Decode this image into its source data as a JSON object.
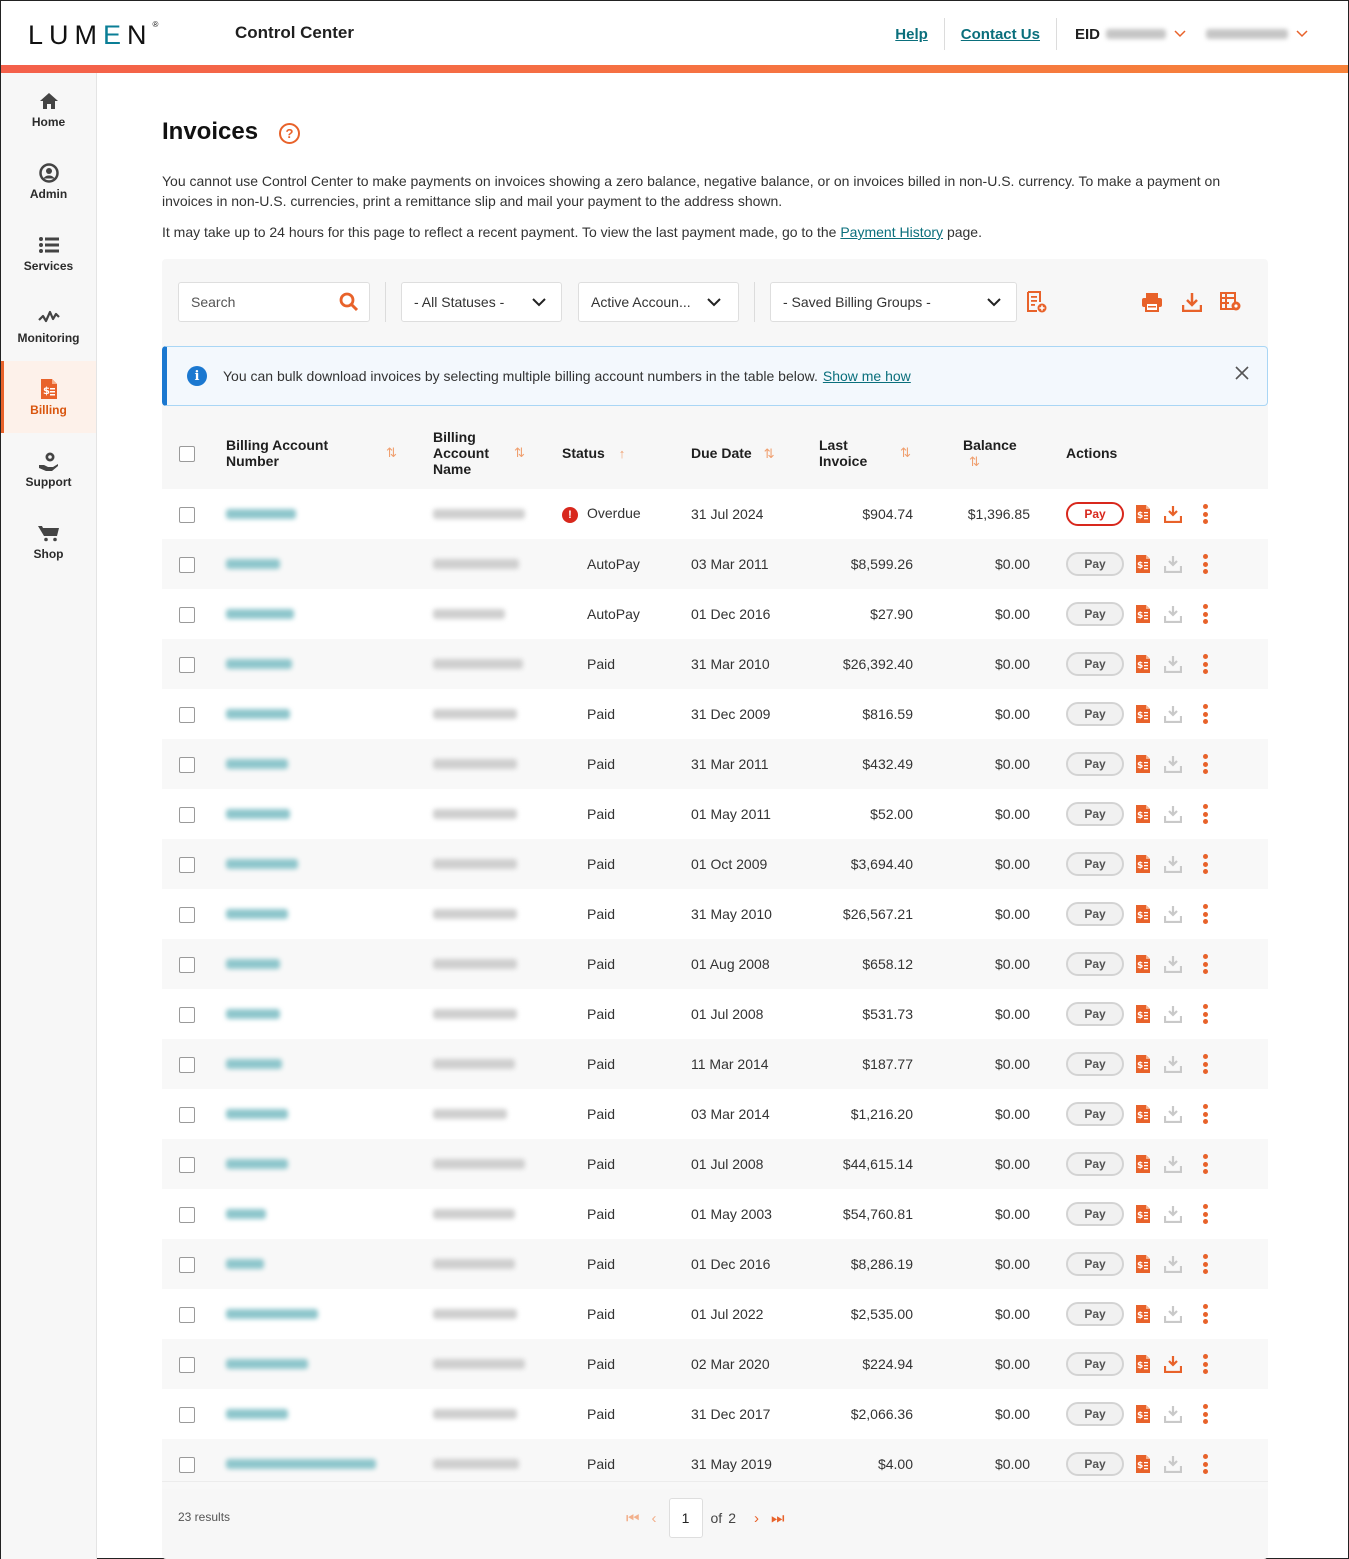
{
  "header": {
    "logo": "LUMEN",
    "app_title": "Control Center",
    "help_label": "Help",
    "contact_label": "Contact Us",
    "eid_label": "EID"
  },
  "sidebar": {
    "items": [
      {
        "label": "Home",
        "icon": "home-icon"
      },
      {
        "label": "Admin",
        "icon": "user-icon"
      },
      {
        "label": "Services",
        "icon": "list-icon"
      },
      {
        "label": "Monitoring",
        "icon": "pulse-icon"
      },
      {
        "label": "Billing",
        "icon": "invoice-icon",
        "active": true
      },
      {
        "label": "Support",
        "icon": "support-icon"
      },
      {
        "label": "Shop",
        "icon": "cart-icon"
      }
    ]
  },
  "page": {
    "title": "Invoices",
    "description": "You cannot use Control Center to make payments on invoices showing a zero balance, negative balance, or on invoices billed in non-U.S. currency. To make a payment on invoices in non-U.S. currencies, print a remittance slip and mail your payment to the address shown.",
    "note_prefix": "It may take up to 24 hours for this page to reflect a recent payment. To view the last payment made, go to the",
    "note_link": "Payment History",
    "note_suffix": "page."
  },
  "toolbar": {
    "search_placeholder": "Search",
    "status_filter": "- All Statuses -",
    "account_filter": "Active Accoun...",
    "billing_groups": "- Saved Billing Groups -"
  },
  "alert": {
    "text": "You can bulk download invoices by selecting multiple billing account numbers in the table below.",
    "link": "Show me how"
  },
  "table": {
    "columns": [
      "Billing Account Number",
      "Billing Account Name",
      "Status",
      "Due Date",
      "Last Invoice",
      "Balance",
      "Actions"
    ],
    "col_ban_1": "Billing Account",
    "col_ban_2": "Number",
    "col_name_1": "Billing",
    "col_name_2": "Account",
    "col_name_3": "Name",
    "col_last_1": "Last",
    "col_last_2": "Invoice",
    "pay_label": "Pay",
    "rows": [
      {
        "status": "Overdue",
        "due": "31 Jul 2024",
        "last": "$904.74",
        "balance": "$1,396.85",
        "payable": true,
        "download": true
      },
      {
        "status": "AutoPay",
        "due": "03 Mar 2011",
        "last": "$8,599.26",
        "balance": "$0.00",
        "payable": false,
        "download": false
      },
      {
        "status": "AutoPay",
        "due": "01 Dec 2016",
        "last": "$27.90",
        "balance": "$0.00",
        "payable": false,
        "download": false
      },
      {
        "status": "Paid",
        "due": "31 Mar 2010",
        "last": "$26,392.40",
        "balance": "$0.00",
        "payable": false,
        "download": false
      },
      {
        "status": "Paid",
        "due": "31 Dec 2009",
        "last": "$816.59",
        "balance": "$0.00",
        "payable": false,
        "download": false
      },
      {
        "status": "Paid",
        "due": "31 Mar 2011",
        "last": "$432.49",
        "balance": "$0.00",
        "payable": false,
        "download": false
      },
      {
        "status": "Paid",
        "due": "01 May 2011",
        "last": "$52.00",
        "balance": "$0.00",
        "payable": false,
        "download": false
      },
      {
        "status": "Paid",
        "due": "01 Oct 2009",
        "last": "$3,694.40",
        "balance": "$0.00",
        "payable": false,
        "download": false
      },
      {
        "status": "Paid",
        "due": "31 May 2010",
        "last": "$26,567.21",
        "balance": "$0.00",
        "payable": false,
        "download": false
      },
      {
        "status": "Paid",
        "due": "01 Aug 2008",
        "last": "$658.12",
        "balance": "$0.00",
        "payable": false,
        "download": false
      },
      {
        "status": "Paid",
        "due": "01 Jul 2008",
        "last": "$531.73",
        "balance": "$0.00",
        "payable": false,
        "download": false
      },
      {
        "status": "Paid",
        "due": "11 Mar 2014",
        "last": "$187.77",
        "balance": "$0.00",
        "payable": false,
        "download": false
      },
      {
        "status": "Paid",
        "due": "03 Mar 2014",
        "last": "$1,216.20",
        "balance": "$0.00",
        "payable": false,
        "download": false
      },
      {
        "status": "Paid",
        "due": "01 Jul 2008",
        "last": "$44,615.14",
        "balance": "$0.00",
        "payable": false,
        "download": false
      },
      {
        "status": "Paid",
        "due": "01 May 2003",
        "last": "$54,760.81",
        "balance": "$0.00",
        "payable": false,
        "download": false
      },
      {
        "status": "Paid",
        "due": "01 Dec 2016",
        "last": "$8,286.19",
        "balance": "$0.00",
        "payable": false,
        "download": false
      },
      {
        "status": "Paid",
        "due": "01 Jul 2022",
        "last": "$2,535.00",
        "balance": "$0.00",
        "payable": false,
        "download": false
      },
      {
        "status": "Paid",
        "due": "02 Mar 2020",
        "last": "$224.94",
        "balance": "$0.00",
        "payable": false,
        "download": true
      },
      {
        "status": "Paid",
        "due": "31 Dec 2017",
        "last": "$2,066.36",
        "balance": "$0.00",
        "payable": false,
        "download": false
      },
      {
        "status": "Paid",
        "due": "31 May 2019",
        "last": "$4.00",
        "balance": "$0.00",
        "payable": false,
        "download": false
      }
    ]
  },
  "footer": {
    "results": "23 results",
    "page": "1",
    "of_label": "of",
    "total_pages": "2"
  },
  "colors": {
    "accent": "#e8622a",
    "link": "#0a6f7c",
    "danger": "#d8281d",
    "info": "#1b78d0"
  }
}
